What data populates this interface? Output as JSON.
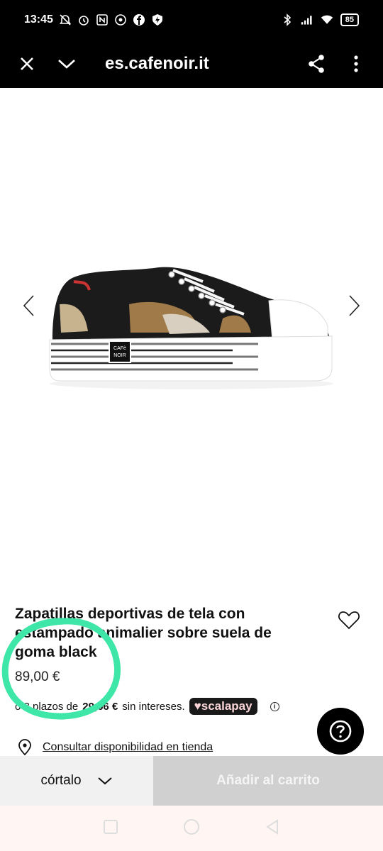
{
  "status_bar": {
    "time": "13:45",
    "battery": "85",
    "icons": [
      "do-not-disturb-icon",
      "alarm-icon",
      "nfc-icon",
      "whatsapp-icon",
      "facebook-icon",
      "shield-icon",
      "bluetooth-icon",
      "signal-icon",
      "wifi-icon",
      "battery-icon"
    ]
  },
  "app_bar": {
    "title": "es.cafenoir.it",
    "icons": [
      "close-icon",
      "chevron-down-icon",
      "share-icon",
      "more-icon"
    ]
  },
  "gallery": {
    "icons": [
      "chevron-left-icon",
      "chevron-right-icon"
    ],
    "image": "sneaker-product-image",
    "logo_text_1": "CAFè",
    "logo_text_2": "NOIR"
  },
  "product": {
    "title": "Zapatillas deportivas de tela con estampado animalier sobre suela de goma black",
    "price": "89,00 €",
    "installment_prefix": "o 3 plazos de",
    "installment_amount": "29,66 €",
    "installment_suffix": "sin intereses.",
    "scalapay": "scalapay",
    "info_icon": "i"
  },
  "store": {
    "link": "Consultar disponibilidad en tienda"
  },
  "actions": {
    "size": "córtalo",
    "cart": "Añadir al carrito"
  },
  "colors": {
    "accent_annotation": "#3ee6a8",
    "bar": "#000000",
    "cart_disabled": "#d0d0d0"
  }
}
